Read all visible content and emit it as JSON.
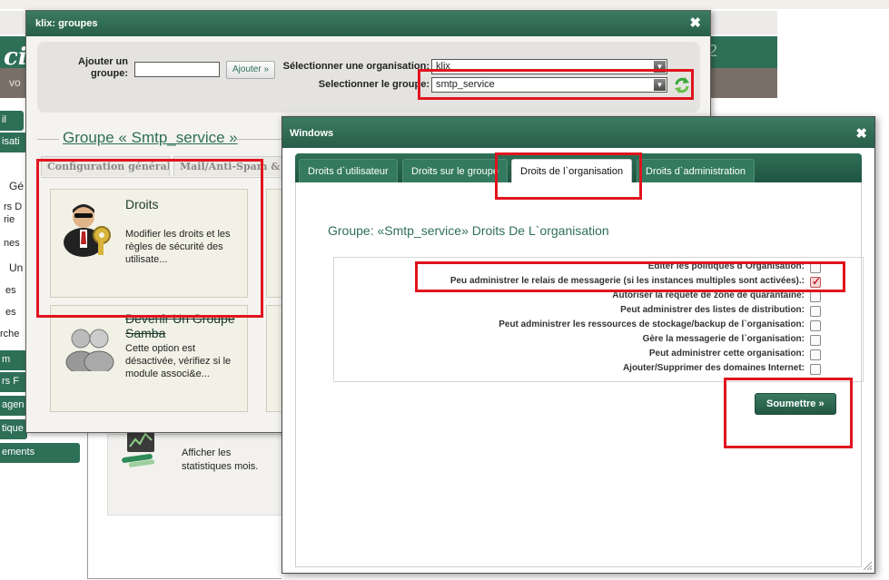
{
  "background": {
    "logo": "ci",
    "banner_number": "2",
    "subbar_text": "vo",
    "sidebar_top": [
      "il",
      "isati"
    ],
    "sidebar_labels": [
      "Gé",
      "rs D",
      "rie",
      "nes",
      "Un",
      "es",
      "es",
      "rche"
    ],
    "sidebar_buttons": [
      "m",
      "rs F",
      "agen",
      "tique",
      "ements"
    ],
    "stats_text": "Afficher les statistiques mois."
  },
  "win1": {
    "title": "klix: groupes",
    "add_group_label": "Ajouter un groupe:",
    "add_group_value": "",
    "add_button": "Ajouter »",
    "select_org_label": "Sélectionner une organisation:",
    "select_org_value": "klix",
    "select_group_label": "Selectionner le groupe:",
    "select_group_value": "smtp_service",
    "group_heading": "Groupe  « Smtp_service »",
    "tabs": [
      "Configuration générale",
      "Mail/Anti-Spam &"
    ],
    "cards": [
      {
        "title": "Droits",
        "desc": "Modifier les droits et les règles de sécurité des utilisate..."
      },
      {
        "title": "Devenir Un Groupe Samba",
        "desc": "Cette option est désactivée, vérifiez si le module associ&e..."
      }
    ]
  },
  "win2": {
    "title": "Windows",
    "tabs": [
      "Droits d`utilisateur",
      "Droits sur le groupe",
      "Droits de l`organisation",
      "Droits d`administration"
    ],
    "active_tab": 2,
    "heading": "Groupe: «Smtp_service»  Droits De L`organisation",
    "permissions": [
      {
        "label": "Editer les politiques d`Organisation:",
        "checked": false
      },
      {
        "label": "Peu administrer le relais de messagerie (si les instances multiples sont activées).:",
        "checked": true
      },
      {
        "label": "Autoriser la requête de zone de quarantaine:",
        "checked": false
      },
      {
        "label": "Peut administrer des listes de distribution:",
        "checked": false
      },
      {
        "label": "Peut administrer les ressources de stockage/backup de l`organisation:",
        "checked": false
      },
      {
        "label": "Gère la messagerie de l`organisation:",
        "checked": false
      },
      {
        "label": "Peut administrer cette organisation:",
        "checked": false
      },
      {
        "label": "Ajouter/Supprimer des domaines Internet:",
        "checked": false
      }
    ],
    "submit_button": "Soumettre  »"
  },
  "colors": {
    "brand_green": "#2e6f57",
    "highlight_red": "#e0141e"
  }
}
